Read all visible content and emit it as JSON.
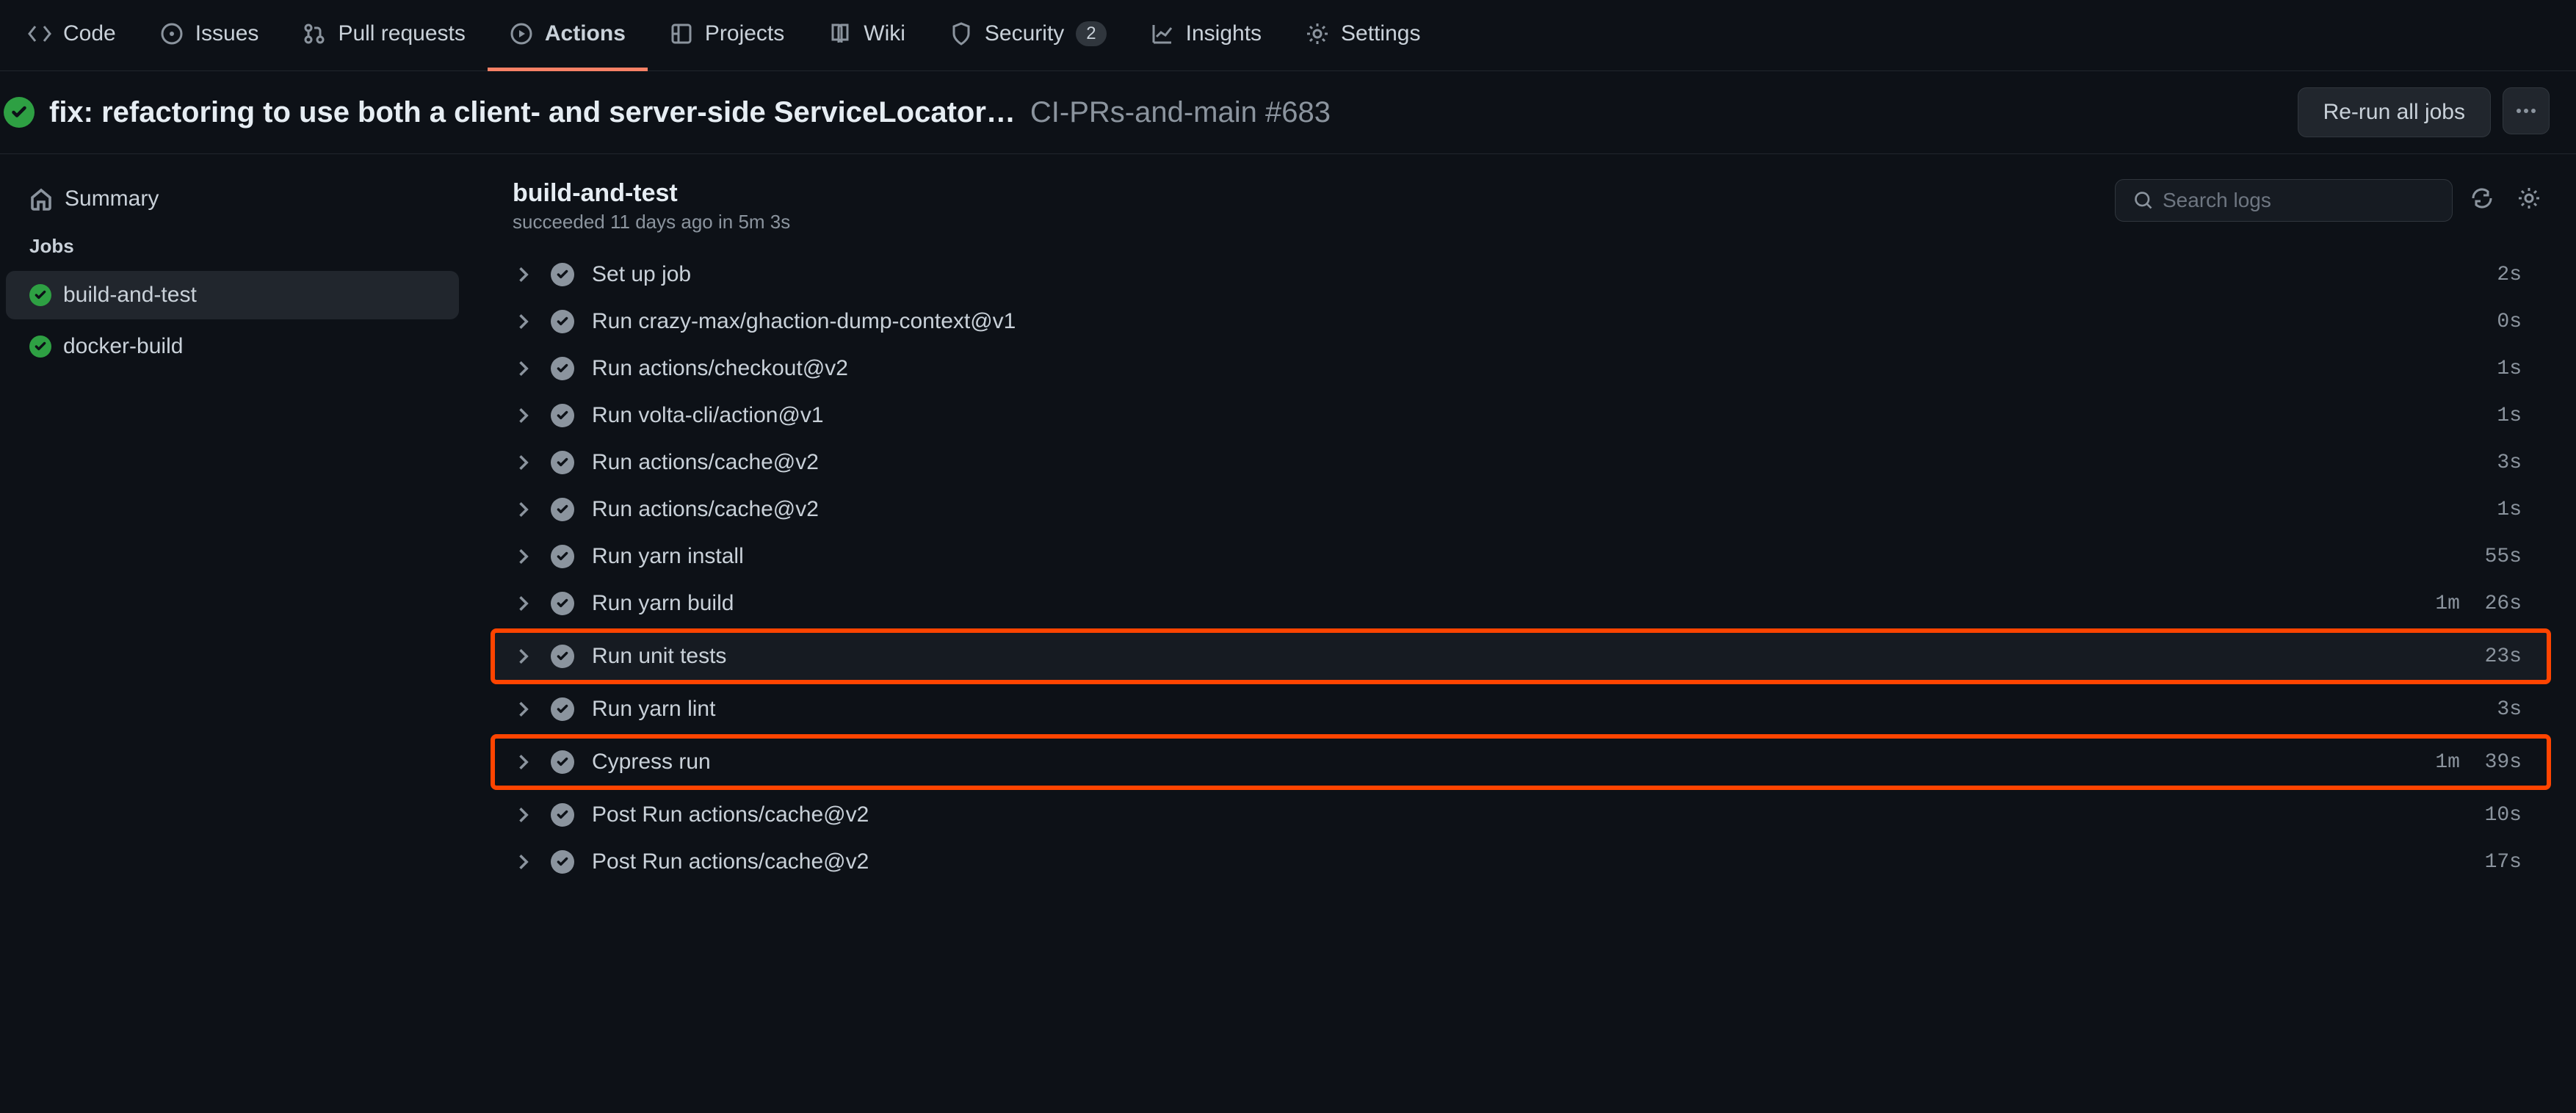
{
  "nav": [
    {
      "label": "Code",
      "icon": "code-icon"
    },
    {
      "label": "Issues",
      "icon": "issue-icon"
    },
    {
      "label": "Pull requests",
      "icon": "pr-icon"
    },
    {
      "label": "Actions",
      "icon": "play-icon",
      "active": true
    },
    {
      "label": "Projects",
      "icon": "project-icon"
    },
    {
      "label": "Wiki",
      "icon": "wiki-icon"
    },
    {
      "label": "Security",
      "icon": "shield-icon",
      "badge": "2"
    },
    {
      "label": "Insights",
      "icon": "graph-icon"
    },
    {
      "label": "Settings",
      "icon": "gear-icon"
    }
  ],
  "header": {
    "title": "fix: refactoring to use both a client- and server-side ServiceLocator…",
    "sub": "CI-PRs-and-main #683",
    "rerun_label": "Re-run all jobs"
  },
  "sidebar": {
    "summary_label": "Summary",
    "jobs_label": "Jobs",
    "jobs": [
      {
        "name": "build-and-test",
        "active": true
      },
      {
        "name": "docker-build"
      }
    ]
  },
  "job": {
    "title": "build-and-test",
    "status": "succeeded",
    "when": "11 days ago",
    "in": "in",
    "duration": "5m 3s",
    "search_placeholder": "Search logs"
  },
  "steps": [
    {
      "name": "Set up job",
      "time": "2s"
    },
    {
      "name": "Run crazy-max/ghaction-dump-context@v1",
      "time": "0s"
    },
    {
      "name": "Run actions/checkout@v2",
      "time": "1s"
    },
    {
      "name": "Run volta-cli/action@v1",
      "time": "1s"
    },
    {
      "name": "Run actions/cache@v2",
      "time": "3s"
    },
    {
      "name": "Run actions/cache@v2",
      "time": "1s"
    },
    {
      "name": "Run yarn install",
      "time": "55s"
    },
    {
      "name": "Run yarn build",
      "time": "1m  26s"
    },
    {
      "name": "Run unit tests",
      "time": "23s",
      "annotated": true,
      "hovered": true
    },
    {
      "name": "Run yarn lint",
      "time": "3s"
    },
    {
      "name": "Cypress run",
      "time": "1m  39s",
      "annotated": true
    },
    {
      "name": "Post Run actions/cache@v2",
      "time": "10s"
    },
    {
      "name": "Post Run actions/cache@v2",
      "time": "17s"
    }
  ]
}
